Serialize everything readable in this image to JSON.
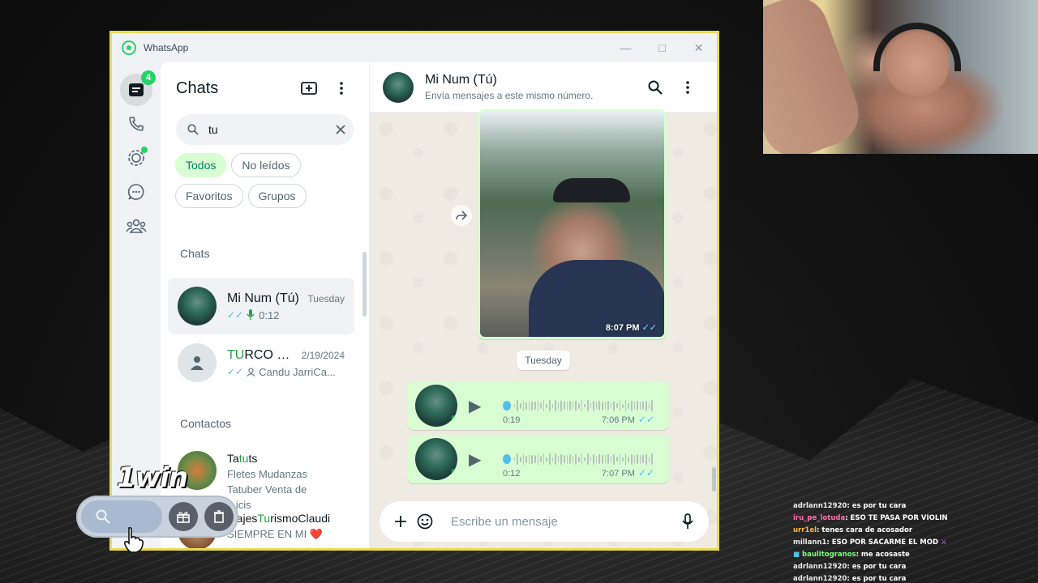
{
  "window": {
    "title": "WhatsApp"
  },
  "rail": {
    "chats_badge": "4"
  },
  "sidebar": {
    "title": "Chats",
    "search_value": "tu",
    "filters": [
      "Todos",
      "No leídos",
      "Favoritos",
      "Grupos"
    ],
    "chats_section": "Chats",
    "chats": [
      {
        "name": "Mi Num (Tú)",
        "time": "Tuesday",
        "preview": "0:12"
      },
      {
        "name_highlight": "TU",
        "name_rest": "RCO N...",
        "time": "2/19/2024",
        "preview": "Candu JarriCa..."
      }
    ],
    "contacts_section": "Contactos",
    "contacts": [
      {
        "name_pre": "Ta",
        "name_highlight": "tu",
        "name_post": "ts",
        "status": "Fletes Mudanzas Tatuber Venta de ...icis"
      },
      {
        "name_pre": "...ajes",
        "name_highlight": "Tu",
        "name_post": "rismoClaudi",
        "status": "SIEMPRE EN MI ❤️"
      }
    ]
  },
  "conversation": {
    "name": "Mi Num (Tú)",
    "subtitle": "Envía mensajes a este mismo número.",
    "image_time": "8:07 PM",
    "date_separator": "Tuesday",
    "voice_notes": [
      {
        "duration": "0:19",
        "time": "7:06 PM"
      },
      {
        "duration": "0:12",
        "time": "7:07 PM"
      }
    ],
    "composer_placeholder": "Escribe un mensaje"
  },
  "promo": {
    "logo": "1win"
  },
  "stream_chat": [
    {
      "user": "adrlann12920",
      "message": ": es por tu cara"
    },
    {
      "user": "iru_pe_lotuda",
      "message": ": ESO TE PASA POR VIOLIN"
    },
    {
      "user": "urr1el",
      "message": ": tenes cara de acosador"
    },
    {
      "user": "millann1",
      "message": ": ESO POR SACARME EL MOD"
    },
    {
      "user": "baulitogranos",
      "message": ": me acosaste"
    },
    {
      "user": "adrlann12920",
      "message": ": es por tu cara"
    },
    {
      "user": "adrlann12920",
      "message": ": es por tu cara"
    }
  ],
  "colors": {
    "accent": "#25d366",
    "bubble_out": "#d9fdd3",
    "window_border": "#e9db52"
  }
}
